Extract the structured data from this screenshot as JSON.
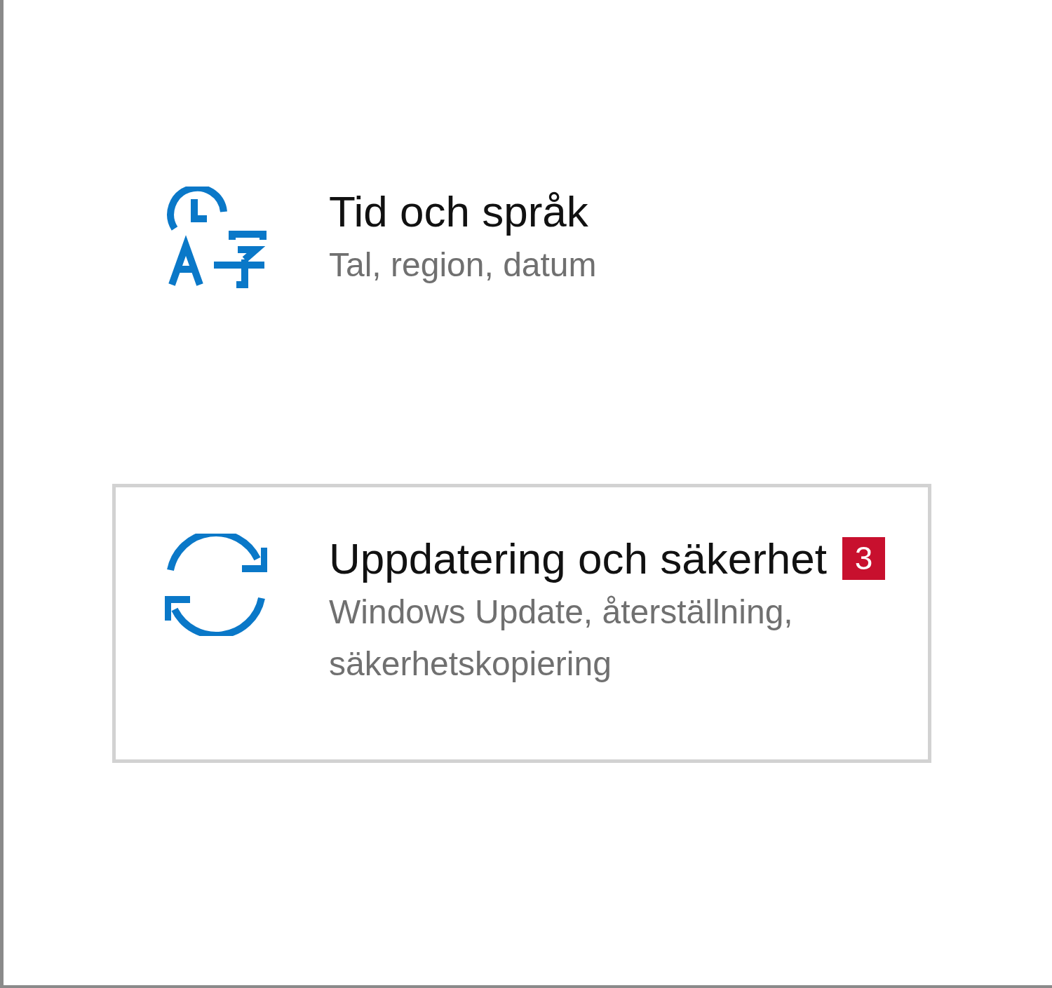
{
  "items": [
    {
      "kind": "time-language",
      "title": "Tid och språk",
      "subtitle": "Tal, region, datum",
      "focused": false
    },
    {
      "kind": "sync",
      "title": "Uppdatering och säkerhet",
      "badge": "3",
      "subtitle": "Windows Update, återställning, säkerhetskopiering",
      "focused": true
    }
  ]
}
